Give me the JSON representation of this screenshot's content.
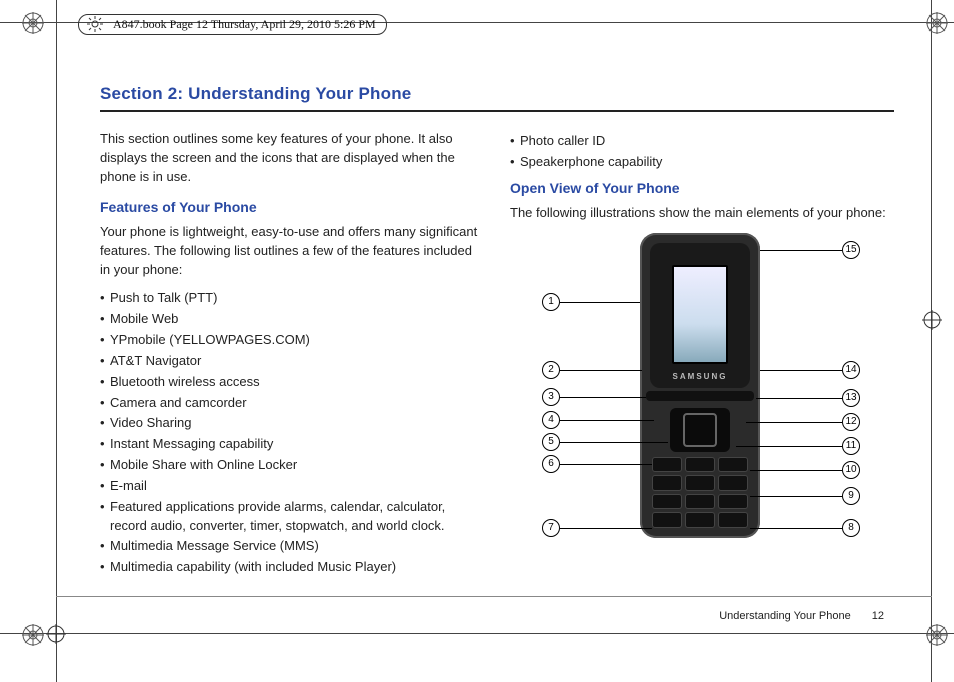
{
  "header": {
    "runner": "A847.book  Page 12  Thursday, April 29, 2010  5:26 PM"
  },
  "section": {
    "title": "Section 2: Understanding Your Phone",
    "intro": "This section outlines some key features of your phone. It also displays the screen and the icons that are displayed when the phone is in use.",
    "features_heading": "Features of Your Phone",
    "features_intro": "Your phone is lightweight, easy-to-use and offers many significant features. The following list outlines a few of the features included in your phone:",
    "features": [
      "Push to Talk (PTT)",
      "Mobile Web",
      "YPmobile (YELLOWPAGES.COM)",
      "AT&T Navigator",
      "Bluetooth wireless access",
      "Camera and camcorder",
      "Video Sharing",
      "Instant Messaging capability",
      "Mobile Share with Online Locker",
      "E-mail",
      "Featured applications provide alarms, calendar, calculator, record audio, converter, timer, stopwatch, and world clock.",
      "Multimedia Message Service (MMS)",
      "Multimedia capability (with included Music Player)"
    ],
    "features_col2": [
      "Photo caller ID",
      "Speakerphone capability"
    ],
    "openview_heading": "Open View of Your Phone",
    "openview_intro": "The following illustrations show the main elements of your phone:",
    "phone_brand": "SAMSUNG",
    "callouts": [
      "1",
      "2",
      "3",
      "4",
      "5",
      "6",
      "7",
      "8",
      "9",
      "10",
      "11",
      "12",
      "13",
      "14",
      "15"
    ]
  },
  "footer": {
    "label": "Understanding Your Phone",
    "page": "12"
  }
}
